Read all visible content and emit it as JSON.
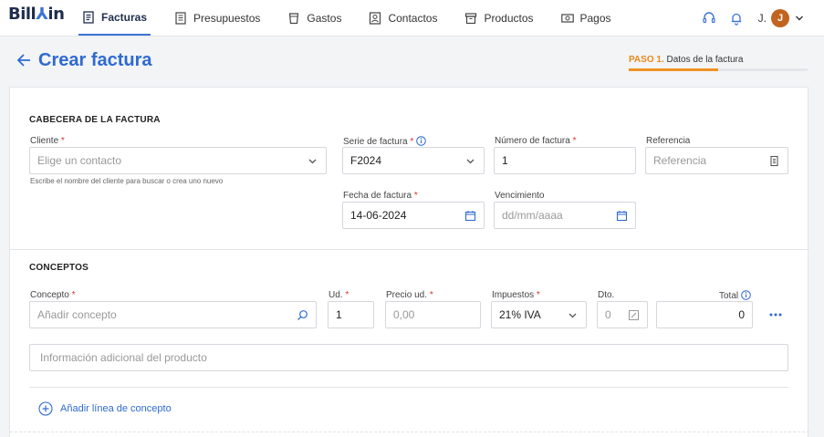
{
  "app": {
    "logo": "Billзin"
  },
  "nav": {
    "items": [
      {
        "label": "Facturas",
        "icon": "invoice-icon",
        "active": true
      },
      {
        "label": "Presupuestos",
        "icon": "quote-icon",
        "active": false
      },
      {
        "label": "Gastos",
        "icon": "cup-icon",
        "active": false
      },
      {
        "label": "Contactos",
        "icon": "contact-icon",
        "active": false
      },
      {
        "label": "Productos",
        "icon": "box-icon",
        "active": false
      },
      {
        "label": "Pagos",
        "icon": "money-icon",
        "active": false
      }
    ],
    "user_initial": "J.",
    "avatar_letter": "J"
  },
  "page": {
    "title": "Crear factura",
    "step_prefix": "PASO 1.",
    "step_label": "Datos de la factura",
    "step_progress": 0.5
  },
  "header_section": {
    "title": "CABECERA DE LA FACTURA",
    "cliente_label": "Cliente",
    "cliente_placeholder": "Elige un contacto",
    "cliente_help": "Escribe el nombre del cliente para buscar o crea uno nuevo",
    "serie_label": "Serie de factura",
    "serie_value": "F2024",
    "numero_label": "Número de factura",
    "numero_value": "1",
    "referencia_label": "Referencia",
    "referencia_placeholder": "Referencia",
    "fecha_label": "Fecha de factura",
    "fecha_value": "14-06-2024",
    "vencimiento_label": "Vencimiento",
    "vencimiento_placeholder": "dd/mm/aaaa",
    "required_mark": "*"
  },
  "concepts_section": {
    "title": "CONCEPTOS",
    "concepto_label": "Concepto",
    "concepto_placeholder": "Añadir concepto",
    "ud_label": "Ud.",
    "ud_value": "1",
    "precio_label": "Precio ud.",
    "precio_placeholder": "0,00",
    "impuestos_label": "Impuestos",
    "impuestos_value": "21% IVA",
    "dto_label": "Dto.",
    "dto_placeholder": "0",
    "total_label": "Total",
    "total_value": "0",
    "info_placeholder": "Información adicional del producto",
    "add_line_label": "Añadir línea de concepto"
  },
  "colors": {
    "accent": "#2e6ad1",
    "nav_active": "#3b73d6",
    "step": "#ef9223",
    "required": "#d9342b",
    "avatar": "#c0641f"
  }
}
